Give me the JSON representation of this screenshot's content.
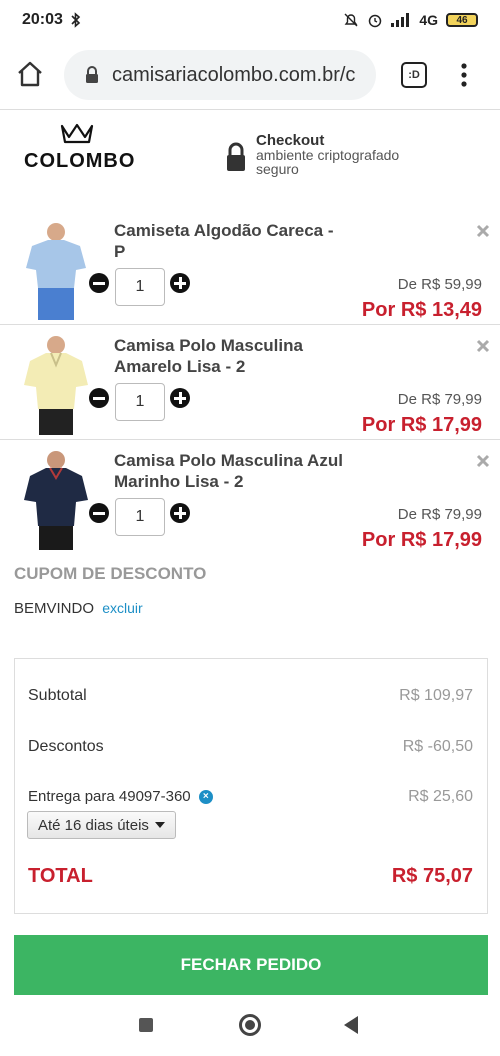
{
  "status": {
    "time": "20:03",
    "network": "4G",
    "battery": "46"
  },
  "browser": {
    "url": "camisariacolombo.com.br/c",
    "tabs_label": ":D"
  },
  "header": {
    "brand": "COLOMBO",
    "secure_title": "Checkout",
    "secure_line1": "ambiente criptografado",
    "secure_line2": "seguro"
  },
  "cart": {
    "items": [
      {
        "name": "Camiseta Algodão Careca - P",
        "qty": "1",
        "old_price": "De R$ 59,99",
        "new_price": "Por R$ 13,49",
        "shirt_color": "#a7c6e8",
        "bottom_color": "#4a7fd0"
      },
      {
        "name": "Camisa Polo Masculina Amarelo Lisa - 2",
        "qty": "1",
        "old_price": "De R$ 79,99",
        "new_price": "Por R$ 17,99",
        "shirt_color": "#f3ecb5",
        "bottom_color": "#222222"
      },
      {
        "name": "Camisa Polo Masculina Azul Marinho Lisa - 2",
        "qty": "1",
        "old_price": "De R$ 79,99",
        "new_price": "Por R$ 17,99",
        "shirt_color": "#1f2a44",
        "bottom_color": "#1a1a1a"
      }
    ]
  },
  "coupon": {
    "title": "CUPOM DE DESCONTO",
    "code": "BEMVINDO",
    "remove_label": "excluir"
  },
  "summary": {
    "subtotal_label": "Subtotal",
    "subtotal_value": "R$ 109,97",
    "discount_label": "Descontos",
    "discount_value": "R$ -60,50",
    "delivery_label": "Entrega para 49097-360",
    "delivery_value": "R$ 25,60",
    "delivery_option": "Até 16 dias úteis",
    "total_label": "TOTAL",
    "total_value": "R$ 75,07"
  },
  "checkout_button": "FECHAR PEDIDO",
  "colors": {
    "accent_red": "#c8202e",
    "button_green": "#3cb563",
    "link_blue": "#1d8fc6"
  }
}
